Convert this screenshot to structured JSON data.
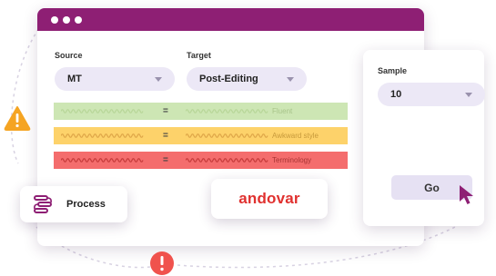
{
  "window": {
    "source_label": "Source",
    "source_value": "MT",
    "target_label": "Target",
    "target_value": "Post-Editing"
  },
  "comparison_rows": [
    {
      "symbol": "=",
      "result": "Fluent",
      "color": "#cde6b4",
      "line_color": "#b9d79a",
      "text_color": "#a8c48a"
    },
    {
      "symbol": "=",
      "result": "Awkward style",
      "color": "#fdd26a",
      "line_color": "#e0a84a",
      "text_color": "#c89a3c"
    },
    {
      "symbol": "=",
      "result": "Terminology",
      "color": "#f46d6d",
      "line_color": "#c83d3d",
      "text_color": "#a83434"
    }
  ],
  "sample_panel": {
    "label": "Sample",
    "value": "10",
    "go_label": "Go"
  },
  "process_card": {
    "label": "Process"
  },
  "brand": {
    "name": "andovar",
    "color": "#e0312f"
  },
  "colors": {
    "titlebar": "#8e1f74",
    "warning": "#f5a422",
    "alert": "#f0524d",
    "accent": "#8e1f74"
  }
}
